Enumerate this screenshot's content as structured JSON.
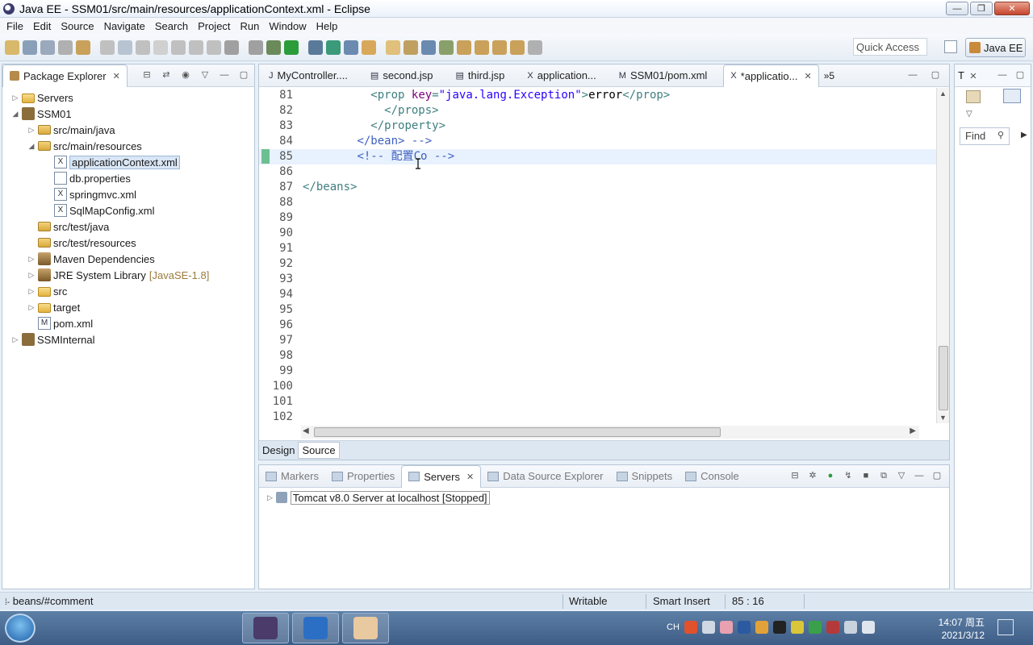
{
  "window": {
    "title": "Java EE - SSM01/src/main/resources/applicationContext.xml - Eclipse",
    "buttons": [
      "—",
      "❐",
      "✕"
    ]
  },
  "menubar": [
    "File",
    "Edit",
    "Source",
    "Navigate",
    "Search",
    "Project",
    "Run",
    "Window",
    "Help"
  ],
  "toolbar": {
    "quick_access": "Quick Access",
    "perspective": "Java EE"
  },
  "package_explorer": {
    "tab_label": "Package Explorer",
    "tree": [
      {
        "label": "Servers",
        "depth": 0,
        "toggle": "▷",
        "icon": "folder"
      },
      {
        "label": "SSM01",
        "depth": 0,
        "toggle": "◢",
        "icon": "project"
      },
      {
        "label": "src/main/java",
        "depth": 1,
        "toggle": "▷",
        "icon": "pkgfolder"
      },
      {
        "label": "src/main/resources",
        "depth": 1,
        "toggle": "◢",
        "icon": "pkgfolder"
      },
      {
        "label": "applicationContext.xml",
        "depth": 2,
        "toggle": "",
        "icon": "xmlfile",
        "selected": true
      },
      {
        "label": "db.properties",
        "depth": 2,
        "toggle": "",
        "icon": "propfile"
      },
      {
        "label": "springmvc.xml",
        "depth": 2,
        "toggle": "",
        "icon": "xmlfile"
      },
      {
        "label": "SqlMapConfig.xml",
        "depth": 2,
        "toggle": "",
        "icon": "xmlfile"
      },
      {
        "label": "src/test/java",
        "depth": 1,
        "toggle": "",
        "icon": "pkgfolder"
      },
      {
        "label": "src/test/resources",
        "depth": 1,
        "toggle": "",
        "icon": "pkgfolder"
      },
      {
        "label": "Maven Dependencies",
        "depth": 1,
        "toggle": "▷",
        "icon": "lib"
      },
      {
        "label": "JRE System Library",
        "suffix": "[JavaSE-1.8]",
        "depth": 1,
        "toggle": "▷",
        "icon": "lib"
      },
      {
        "label": "src",
        "depth": 1,
        "toggle": "▷",
        "icon": "folder"
      },
      {
        "label": "target",
        "depth": 1,
        "toggle": "▷",
        "icon": "folder"
      },
      {
        "label": "pom.xml",
        "depth": 1,
        "toggle": "",
        "icon": "mfile"
      },
      {
        "label": "SSMInternal",
        "depth": 0,
        "toggle": "▷",
        "icon": "project"
      }
    ]
  },
  "editor": {
    "tabs": [
      {
        "label": "MyController....",
        "icon": "J"
      },
      {
        "label": "second.jsp",
        "icon": "▤"
      },
      {
        "label": "third.jsp",
        "icon": "▤"
      },
      {
        "label": "application...",
        "icon": "X"
      },
      {
        "label": "SSM01/pom.xml",
        "icon": "M"
      },
      {
        "label": "*applicatio...",
        "icon": "X",
        "active": true
      }
    ],
    "overflow": "»5",
    "current_line": 85,
    "lines": [
      {
        "n": "81",
        "html": "          <span class=\"tag\">&lt;prop</span> <span class=\"attr\">key</span>=<span class=\"val\">\"java.lang.Exception\"</span><span class=\"tag\">&gt;</span><span class=\"txt\">error</span><span class=\"tag\">&lt;/prop&gt;</span>"
      },
      {
        "n": "82",
        "html": "            <span class=\"tag\">&lt;/props&gt;</span>"
      },
      {
        "n": "83",
        "html": "          <span class=\"tag\">&lt;/property&gt;</span>"
      },
      {
        "n": "84",
        "html": "        <span class=\"cmt\">&lt;/bean&gt; --&gt;</span>"
      },
      {
        "n": "85",
        "html": "        <span class=\"cmt\">&lt;!-- 配置Co --&gt;</span>"
      },
      {
        "n": "86",
        "html": ""
      },
      {
        "n": "87",
        "html": "<span class=\"tag\">&lt;/beans&gt;</span>"
      },
      {
        "n": "88",
        "html": ""
      },
      {
        "n": "89",
        "html": ""
      },
      {
        "n": "90",
        "html": ""
      },
      {
        "n": "91",
        "html": ""
      },
      {
        "n": "92",
        "html": ""
      },
      {
        "n": "93",
        "html": ""
      },
      {
        "n": "94",
        "html": ""
      },
      {
        "n": "95",
        "html": ""
      },
      {
        "n": "96",
        "html": ""
      },
      {
        "n": "97",
        "html": ""
      },
      {
        "n": "98",
        "html": ""
      },
      {
        "n": "99",
        "html": ""
      },
      {
        "n": "100",
        "html": ""
      },
      {
        "n": "101",
        "html": ""
      },
      {
        "n": "102",
        "html": ""
      }
    ],
    "bottom_tabs": [
      "Design",
      "Source"
    ],
    "active_bottom_tab": "Source"
  },
  "servers_panel": {
    "tabs": [
      {
        "label": "Markers",
        "active": false
      },
      {
        "label": "Properties",
        "active": false
      },
      {
        "label": "Servers",
        "active": true
      },
      {
        "label": "Data Source Explorer",
        "active": false
      },
      {
        "label": "Snippets",
        "active": false
      },
      {
        "label": "Console",
        "active": false
      }
    ],
    "server": "Tomcat v8.0 Server at localhost  [Stopped]"
  },
  "outline_panel": {
    "tab": "T",
    "find": "Find"
  },
  "statusbar": {
    "path": "beans/#comment",
    "writable": "Writable",
    "insert_mode": "Smart Insert",
    "position": "85 : 16"
  },
  "taskbar": {
    "lang": "CH",
    "time": "14:07 周五",
    "date": "2021/3/12",
    "colors": {
      "eclipse": "#4a3b6b",
      "word": "#2b6fc5",
      "app3": "#e8c9a0"
    }
  }
}
